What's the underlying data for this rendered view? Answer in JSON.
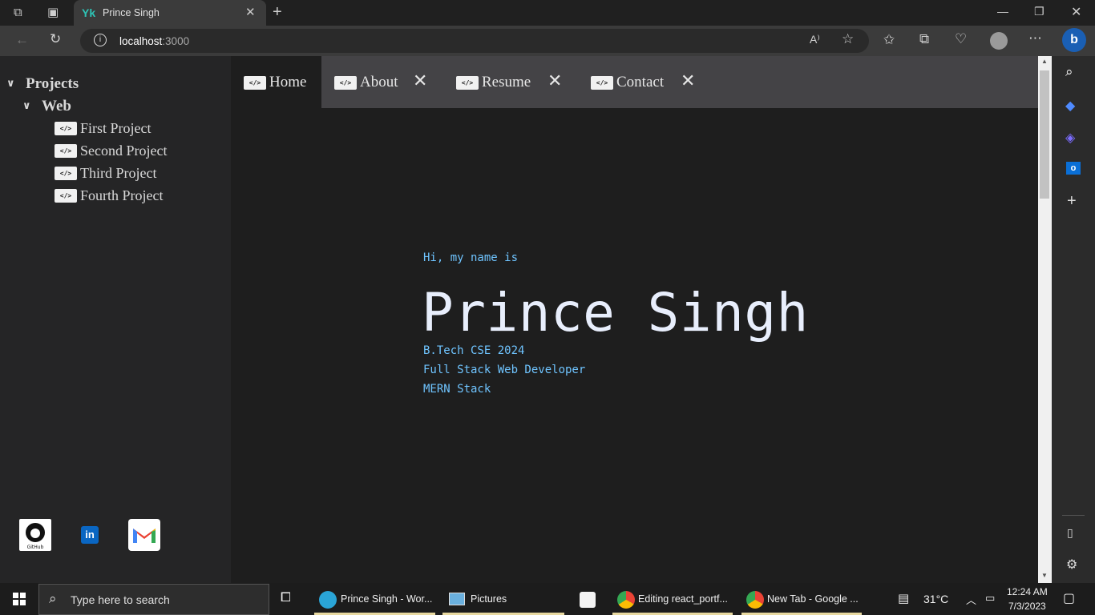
{
  "browser": {
    "tab_title": "Prince Singh",
    "tab_favicon": "Yk",
    "url_host": "localhost",
    "url_port": ":3000"
  },
  "explorer": {
    "root_folder": "Projects",
    "sub_folder": "Web",
    "files": [
      "First Project",
      "Second Project",
      "Third Project",
      "Fourth Project"
    ]
  },
  "editor_tabs": [
    {
      "label": "Home",
      "active": true,
      "closable": false
    },
    {
      "label": "About",
      "active": false,
      "closable": true
    },
    {
      "label": "Resume",
      "active": false,
      "closable": true
    },
    {
      "label": "Contact",
      "active": false,
      "closable": true
    }
  ],
  "hero": {
    "greeting": "Hi, my name is",
    "name": "Prince Singh",
    "lines": [
      "B.Tech CSE 2024",
      "Full Stack Web Developer",
      "MERN Stack"
    ]
  },
  "social": [
    {
      "name": "github-icon",
      "label": "GitHub"
    },
    {
      "name": "linkedin-icon",
      "label": "in"
    },
    {
      "name": "gmail-icon",
      "label": "M"
    }
  ],
  "taskbar": {
    "search_placeholder": "Type here to search",
    "apps": [
      {
        "label": "Prince Singh - Wor..."
      },
      {
        "label": "Pictures"
      },
      {
        "label": "Editing react_portf..."
      },
      {
        "label": "New Tab - Google ..."
      }
    ],
    "weather": "31°C",
    "time": "12:24 AM",
    "date": "7/3/2023"
  },
  "colors": {
    "accent_blue": "#6fc4ff",
    "name_color": "#e8eefc",
    "page_bg": "#1e1e1e",
    "sidebar_bg": "#252526",
    "tabbar_bg": "#444346"
  }
}
